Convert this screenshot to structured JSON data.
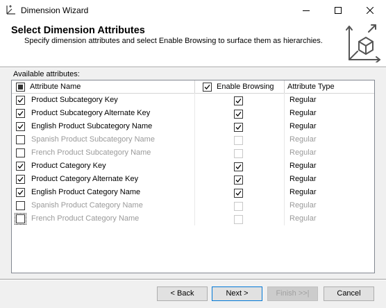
{
  "window": {
    "title": "Dimension Wizard"
  },
  "header": {
    "title": "Select Dimension Attributes",
    "subtitle": "Specify dimension attributes and select Enable Browsing to surface them as hierarchies."
  },
  "grid": {
    "label": "Available attributes:",
    "columns": {
      "name": "Attribute Name",
      "browsing": "Enable Browsing",
      "type": "Attribute Type"
    },
    "header_select_all": "partial",
    "header_browsing_checked": true,
    "rows": [
      {
        "name": "Product Subcategory Key",
        "selected": true,
        "browsing": true,
        "type": "Regular"
      },
      {
        "name": "Product Subcategory Alternate Key",
        "selected": true,
        "browsing": true,
        "type": "Regular"
      },
      {
        "name": "English Product Subcategory Name",
        "selected": true,
        "browsing": true,
        "type": "Regular"
      },
      {
        "name": "Spanish Product Subcategory Name",
        "selected": false,
        "browsing": false,
        "type": "Regular"
      },
      {
        "name": "French Product Subcategory Name",
        "selected": false,
        "browsing": false,
        "type": "Regular"
      },
      {
        "name": "Product Category Key",
        "selected": true,
        "browsing": true,
        "type": "Regular"
      },
      {
        "name": "Product Category Alternate Key",
        "selected": true,
        "browsing": true,
        "type": "Regular"
      },
      {
        "name": "English Product Category Name",
        "selected": true,
        "browsing": true,
        "type": "Regular"
      },
      {
        "name": "Spanish Product Category Name",
        "selected": false,
        "browsing": false,
        "type": "Regular"
      },
      {
        "name": "French Product Category Name",
        "selected": false,
        "browsing": false,
        "type": "Regular"
      }
    ]
  },
  "buttons": {
    "back": "< Back",
    "next": "Next >",
    "finish": "Finish >>|",
    "cancel": "Cancel"
  },
  "colors": {
    "accent": "#0078d7",
    "disabled_text": "#9a9a9a"
  },
  "icons": {
    "app": "dimension-wizard-icon",
    "minimize": "minimize-icon",
    "maximize": "maximize-icon",
    "close": "close-icon",
    "header": "cube-axes-icon"
  }
}
